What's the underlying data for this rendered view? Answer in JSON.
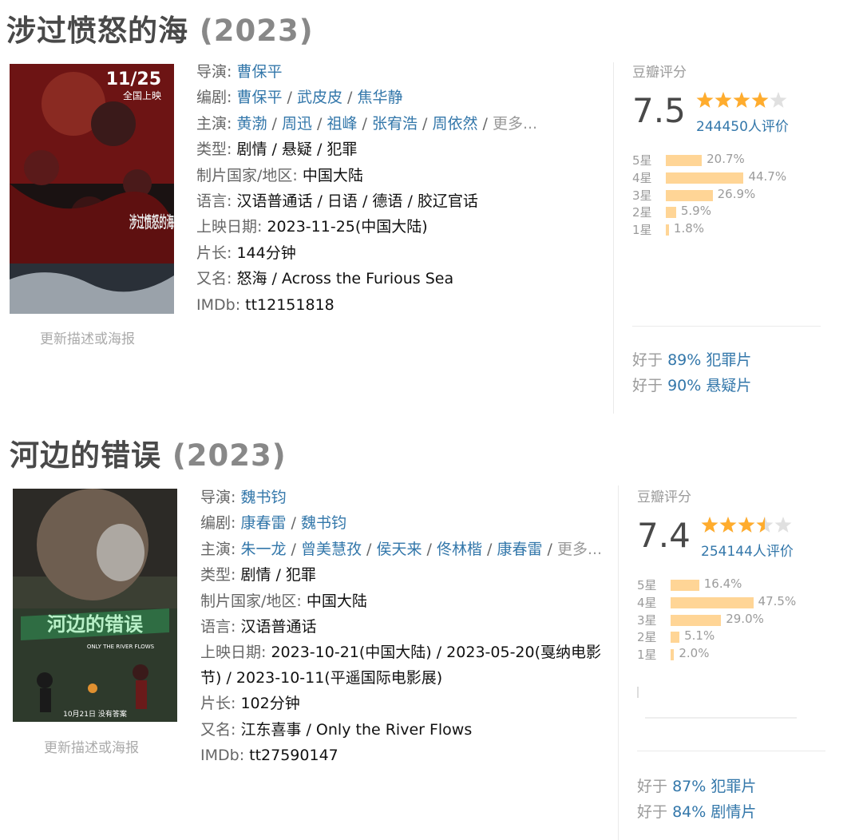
{
  "movies": [
    {
      "title": "涉过愤怒的海",
      "year": "(2023)",
      "poster_link": "更新描述或海报",
      "poster_text": {
        "date": "11/25",
        "release": "全国上映",
        "title": "涉过愤怒的海"
      },
      "director_label": "导演:",
      "directors": [
        "曹保平"
      ],
      "writer_label": "编剧:",
      "writers": [
        "曹保平",
        "武皮皮",
        "焦华静"
      ],
      "cast_label": "主演:",
      "cast": [
        "黄渤",
        "周迅",
        "祖峰",
        "张宥浩",
        "周依然"
      ],
      "more": "更多...",
      "genre_label": "类型:",
      "genre": "剧情 / 悬疑 / 犯罪",
      "country_label": "制片国家/地区:",
      "country": "中国大陆",
      "language_label": "语言:",
      "language": "汉语普通话 / 日语 / 德语 / 胶辽官话",
      "release_label": "上映日期:",
      "release": "2023-11-25(中国大陆)",
      "runtime_label": "片长:",
      "runtime": "144分钟",
      "aka_label": "又名:",
      "aka": "怒海 / Across the Furious Sea",
      "imdb_label": "IMDb:",
      "imdb": "tt12151818",
      "rating_label": "豆瓣评分",
      "score": "7.5",
      "stars_value": 4,
      "count": "244450人评价",
      "distribution": [
        {
          "label": "5星",
          "pct": "20.7%",
          "value": 20.7
        },
        {
          "label": "4星",
          "pct": "44.7%",
          "value": 44.7
        },
        {
          "label": "3星",
          "pct": "26.9%",
          "value": 26.9
        },
        {
          "label": "2星",
          "pct": "5.9%",
          "value": 5.9
        },
        {
          "label": "1星",
          "pct": "1.8%",
          "value": 1.8
        }
      ],
      "better_than": [
        {
          "prefix": "好于",
          "pct": "89%",
          "genre": "犯罪片"
        },
        {
          "prefix": "好于",
          "pct": "90%",
          "genre": "悬疑片"
        }
      ]
    },
    {
      "title": "河边的错误",
      "year": "(2023)",
      "poster_link": "更新描述或海报",
      "poster_text": {
        "title": "河边的错误",
        "en": "ONLY THE RIVER FLOWS",
        "date": "10月21日 没有答案"
      },
      "director_label": "导演:",
      "directors": [
        "魏书钧"
      ],
      "writer_label": "编剧:",
      "writers": [
        "康春雷",
        "魏书钧"
      ],
      "cast_label": "主演:",
      "cast": [
        "朱一龙",
        "曾美慧孜",
        "侯天来",
        "佟林楷",
        "康春雷"
      ],
      "more": "更多...",
      "genre_label": "类型:",
      "genre": "剧情 / 犯罪",
      "country_label": "制片国家/地区:",
      "country": "中国大陆",
      "language_label": "语言:",
      "language": "汉语普通话",
      "release_label": "上映日期:",
      "release": "2023-10-21(中国大陆) / 2023-05-20(戛纳电影节) / 2023-10-11(平遥国际电影展)",
      "runtime_label": "片长:",
      "runtime": "102分钟",
      "aka_label": "又名:",
      "aka": "江东喜事 / Only the River Flows",
      "imdb_label": "IMDb:",
      "imdb": "tt27590147",
      "rating_label": "豆瓣评分",
      "score": "7.4",
      "stars_value": 3.5,
      "count": "254144人评价",
      "distribution": [
        {
          "label": "5星",
          "pct": "16.4%",
          "value": 16.4
        },
        {
          "label": "4星",
          "pct": "47.5%",
          "value": 47.5
        },
        {
          "label": "3星",
          "pct": "29.0%",
          "value": 29.0
        },
        {
          "label": "2星",
          "pct": "5.1%",
          "value": 5.1
        },
        {
          "label": "1星",
          "pct": "2.0%",
          "value": 2.0
        }
      ],
      "better_than": [
        {
          "prefix": "好于",
          "pct": "87%",
          "genre": "犯罪片"
        },
        {
          "prefix": "好于",
          "pct": "84%",
          "genre": "剧情片"
        }
      ]
    }
  ],
  "colors": {
    "link": "#3377aa",
    "bar": "#ffd596",
    "star": "#ffac2d",
    "star_empty": "#e0e0e0"
  }
}
